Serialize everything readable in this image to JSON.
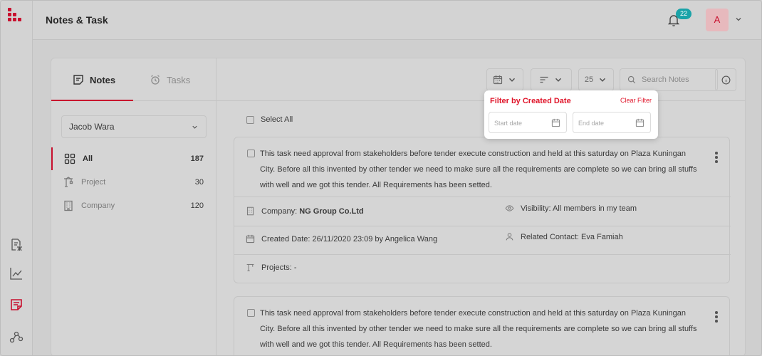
{
  "app": {
    "title": "Notes & Task"
  },
  "header": {
    "notifications_count": "22",
    "avatar_initial": "A"
  },
  "tabs": [
    {
      "label": "Notes",
      "active": true
    },
    {
      "label": "Tasks",
      "active": false
    }
  ],
  "filter_person": {
    "value": "Jacob Wara"
  },
  "categories": [
    {
      "label": "All",
      "count": "187",
      "icon": "grid-icon",
      "active": true
    },
    {
      "label": "Project",
      "count": "30",
      "icon": "crane-icon",
      "active": false
    },
    {
      "label": "Company",
      "count": "120",
      "icon": "building-icon",
      "active": false
    }
  ],
  "toolbar": {
    "page_size": "25",
    "search_placeholder": "Search Notes"
  },
  "list": {
    "select_all_label": "Select All"
  },
  "notes": [
    {
      "text": "This task need approval from stakeholders before tender execute construction and held at this saturday on Plaza Kuningan City. Before all this invented by other tender we need to make sure all the requirements are complete so we can bring all stuffs with well and we got this tender. All Requirements has been setted.",
      "company_label": "Company: ",
      "company_value": "NG Group Co.Ltd",
      "visibility": "Visibility: All members in my team",
      "created": "Created Date: 26/11/2020 23:09 by Angelica Wang",
      "related_contact": "Related Contact: Eva Famiah",
      "projects": "Projects: -"
    },
    {
      "text": "This task need approval from stakeholders before tender execute construction and held at this saturday on Plaza Kuningan City. Before all this invented by other tender we need to make sure all the requirements are complete so we can bring all stuffs with well and we got this tender. All Requirements has been setted."
    }
  ],
  "date_filter": {
    "title": "Filter by Created Date",
    "clear_label": "Clear Filter",
    "start_placeholder": "Start date",
    "end_placeholder": "End date"
  },
  "colors": {
    "brand": "#c8102e",
    "badge": "#1aa3a8",
    "popup_accent": "#e0162b"
  }
}
